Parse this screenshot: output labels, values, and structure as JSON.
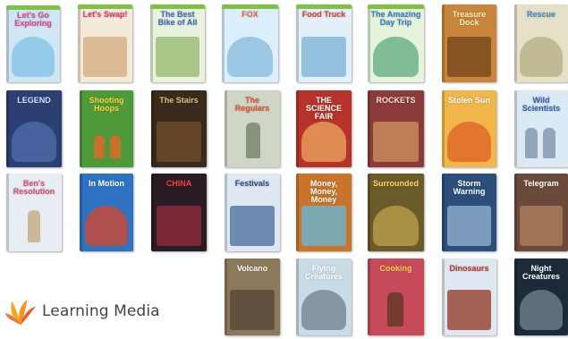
{
  "logo": {
    "text": "Learning Media",
    "colors": {
      "petal_1": "#f5a623",
      "petal_2": "#f7931e",
      "petal_3": "#f15a29",
      "text": "#444444"
    }
  },
  "books": [
    {
      "id": "lets-go-exploring",
      "title": "Let's Go Exploring",
      "bg": "#cfe6f5",
      "fg": "#e23d8a",
      "art": "#8cc4e8",
      "band": "#7fc242"
    },
    {
      "id": "lets-swap",
      "title": "Let's Swap!",
      "bg": "#f4ead8",
      "fg": "#e0316f",
      "art": "#d7b28a",
      "band": "#7fc242"
    },
    {
      "id": "best-bike",
      "title": "The Best Bike of All",
      "bg": "#e9f1df",
      "fg": "#3b6ab8",
      "art": "#9fbf7a",
      "band": "#7fc242"
    },
    {
      "id": "fox",
      "title": "FOX",
      "bg": "#dcefff",
      "fg": "#e8632b",
      "art": "#8fbfe0",
      "band": "#7fc242"
    },
    {
      "id": "food-truck",
      "title": "Food Truck",
      "bg": "#e3f0fa",
      "fg": "#d63a2f",
      "art": "#86b8d9",
      "band": "#7fc242"
    },
    {
      "id": "amazing-day-trip",
      "title": "The Amazing Day Trip",
      "bg": "#e4f3d9",
      "fg": "#2e7bbf",
      "art": "#6fb28a",
      "band": "#7fc242"
    },
    {
      "id": "treasure-dock",
      "title": "Treasure Dock",
      "bg": "#c9853b",
      "fg": "#fff2c2",
      "art": "#7a4a1f",
      "band": "#7fc242"
    },
    {
      "id": "rescue",
      "title": "Rescue",
      "bg": "#e6e0c8",
      "fg": "#3a88c9",
      "art": "#b9b489",
      "band": "#7fc242"
    },
    {
      "id": "legend",
      "title": "LEGEND",
      "bg": "#2c3f72",
      "fg": "#d6e4ff",
      "art": "#4b6aa8",
      "band": "#2c3f72"
    },
    {
      "id": "basketball",
      "title": "Shooting Hoops",
      "bg": "#4e9a3a",
      "fg": "#ffd43b",
      "art": "#d86a2b",
      "band": "#4e9a3a"
    },
    {
      "id": "dark-stairs",
      "title": "The Stairs",
      "bg": "#3a2a1c",
      "fg": "#d9c27a",
      "art": "#6b4a2a",
      "band": "#3a2a1c"
    },
    {
      "id": "the-regulars",
      "title": "The Regulars",
      "bg": "#cfd6c8",
      "fg": "#e04a26",
      "art": "#7f8c75",
      "band": "#cfd6c8"
    },
    {
      "id": "science-fair",
      "title": "THE SCIENCE FAIR",
      "bg": "#b5332a",
      "fg": "#ffffff",
      "art": "#e79a5a",
      "band": "#b5332a"
    },
    {
      "id": "rocket",
      "title": "ROCKETS",
      "bg": "#8a3b3a",
      "fg": "#f3e6c8",
      "art": "#c58a5a",
      "band": "#8a3b3a"
    },
    {
      "id": "stolen-sun",
      "title": "Stolen Sun",
      "bg": "#f0b64a",
      "fg": "#ffffff",
      "art": "#e06a2a",
      "band": "#f0b64a"
    },
    {
      "id": "scientists",
      "title": "Wild Scientists",
      "bg": "#dbe9f4",
      "fg": "#2f5fa8",
      "art": "#8a9db5",
      "band": "#dbe9f4"
    },
    {
      "id": "bens-resolution",
      "title": "Ben's Resolution",
      "bg": "#e7edf2",
      "fg": "#d64a7a",
      "art": "#c9b08e",
      "band": "#e7edf2"
    },
    {
      "id": "in-motion",
      "title": "In Motion",
      "bg": "#2d73c2",
      "fg": "#ffffff",
      "art": "#c74a3a",
      "band": "#2d73c2"
    },
    {
      "id": "china",
      "title": "CHINA",
      "bg": "#2a1c24",
      "fg": "#ff3b3b",
      "art": "#8a2a3a",
      "band": "#2a1c24"
    },
    {
      "id": "festival",
      "title": "Festivals",
      "bg": "#dfe8f2",
      "fg": "#2a4b7a",
      "art": "#5b7aa6",
      "band": "#dfe8f2"
    },
    {
      "id": "money-money",
      "title": "Money, Money, Money",
      "bg": "#c8742a",
      "fg": "#ffffff",
      "art": "#6fb3c9",
      "band": "#c8742a"
    },
    {
      "id": "surrounded",
      "title": "Surrounded",
      "bg": "#6b5a2a",
      "fg": "#ffd966",
      "art": "#b59a4a",
      "band": "#6b5a2a"
    },
    {
      "id": "storm-warning",
      "title": "Storm Warning",
      "bg": "#2b4f7a",
      "fg": "#ffffff",
      "art": "#8aa9c9",
      "band": "#2b4f7a"
    },
    {
      "id": "telegram",
      "title": "Telegram",
      "bg": "#6a4a3a",
      "fg": "#ffffff",
      "art": "#a87a5a",
      "band": "#6a4a3a"
    },
    {
      "id": "volcano",
      "title": "Volcano",
      "bg": "#8a7a5a",
      "fg": "#ffffff",
      "art": "#5a4a3a",
      "band": "#8a7a5a"
    },
    {
      "id": "flying",
      "title": "Flying Creatures",
      "bg": "#c9dbe6",
      "fg": "#ffffff",
      "art": "#7a8a99",
      "band": "#c9dbe6"
    },
    {
      "id": "cooking",
      "title": "Cooking",
      "bg": "#c64a5a",
      "fg": "#ffd34a",
      "art": "#6a3a2a",
      "band": "#c64a5a"
    },
    {
      "id": "dinosaurs",
      "title": "Dinosaurs",
      "bg": "#dfe7f0",
      "fg": "#b5352a",
      "art": "#9a4a3a",
      "band": "#dfe7f0"
    },
    {
      "id": "night-creatures",
      "title": "Night Creatures",
      "bg": "#1c2a3a",
      "fg": "#ffffff",
      "art": "#6a7a8a",
      "band": "#1c2a3a"
    }
  ]
}
